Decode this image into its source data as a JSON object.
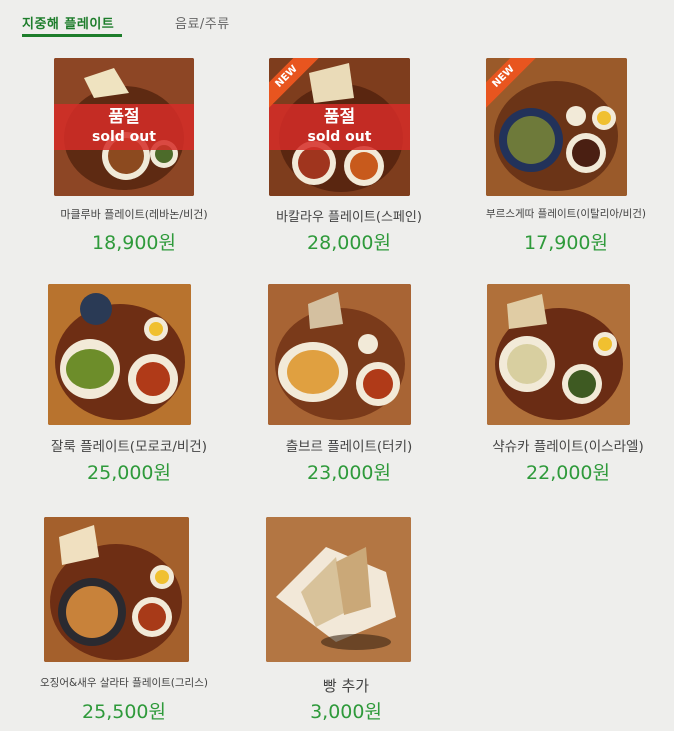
{
  "tabs": [
    {
      "label": "지중해 플레이트",
      "active": true
    },
    {
      "label": "음료/주류",
      "active": false
    }
  ],
  "items": [
    {
      "name": "마클루바 플레이트(레바논/비건)",
      "price": "18,900원",
      "sold_out": true,
      "sold_out_ko": "품절",
      "sold_out_en": "sold out",
      "badge": ""
    },
    {
      "name": "바칼라우 플레이트(스페인)",
      "price": "28,000원",
      "sold_out": true,
      "sold_out_ko": "품절",
      "sold_out_en": "sold out",
      "badge": "NEW"
    },
    {
      "name": "부르스게따 플레이트(이탈리아/비건)",
      "price": "17,900원",
      "sold_out": false,
      "badge": "NEW"
    },
    {
      "name": "잘룩 플레이트(모로코/비건)",
      "price": "25,000원",
      "sold_out": false,
      "badge": ""
    },
    {
      "name": "츨브르 플레이트(터키)",
      "price": "23,000원",
      "sold_out": false,
      "badge": ""
    },
    {
      "name": "샥슈카 플레이트(이스라엘)",
      "price": "22,000원",
      "sold_out": false,
      "badge": ""
    },
    {
      "name": "오징어&새우 살라타 플레이트(그리스)",
      "price": "25,500원",
      "sold_out": false,
      "badge": ""
    },
    {
      "name": "빵 추가",
      "price": "3,000원",
      "sold_out": false,
      "badge": ""
    }
  ],
  "colors": {
    "accent": "#1d7d2b",
    "price": "#2f9a3b",
    "sold_out": "#d62d28",
    "badge": "#e8551f"
  }
}
